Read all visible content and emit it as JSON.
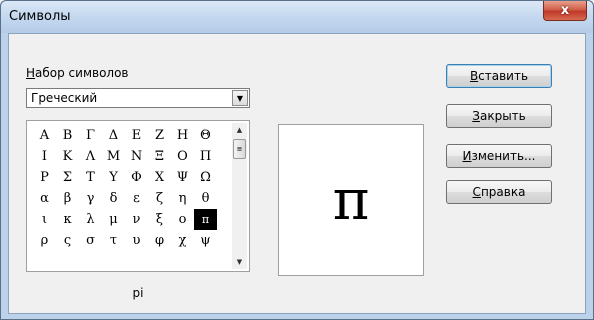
{
  "window": {
    "title": "Символы",
    "close_label": "x"
  },
  "charset": {
    "label_first": "Н",
    "label_rest": "абор символов",
    "selected": "Греческий"
  },
  "symbols": {
    "rows": [
      [
        "Α",
        "Β",
        "Γ",
        "Δ",
        "Ε",
        "Ζ",
        "Η",
        "Θ"
      ],
      [
        "Ι",
        "Κ",
        "Λ",
        "Μ",
        "Ν",
        "Ξ",
        "Ο",
        "Π"
      ],
      [
        "Ρ",
        "Σ",
        "Τ",
        "Υ",
        "Φ",
        "Χ",
        "Ψ",
        "Ω"
      ],
      [
        "α",
        "β",
        "γ",
        "δ",
        "ε",
        "ζ",
        "η",
        "θ"
      ],
      [
        "ι",
        "κ",
        "λ",
        "μ",
        "ν",
        "ξ",
        "ο",
        "π"
      ],
      [
        "ρ",
        "ς",
        "σ",
        "τ",
        "υ",
        "φ",
        "χ",
        "ψ"
      ]
    ],
    "selected_char": "π",
    "selected_name": "pi"
  },
  "preview": {
    "char": "π"
  },
  "buttons": [
    {
      "first": "В",
      "rest": "ставить",
      "default": true
    },
    {
      "first": "З",
      "rest": "акрыть",
      "default": false
    },
    {
      "first": "И",
      "rest": "зменить...",
      "default": false
    },
    {
      "first": "С",
      "rest": "правка",
      "default": false
    }
  ]
}
